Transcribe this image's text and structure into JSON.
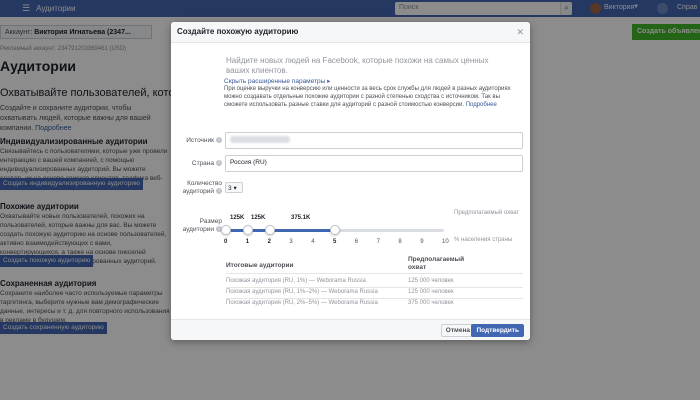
{
  "topbar": {
    "menu_icon": "menu-icon",
    "title": "Аудитории",
    "search_placeholder": "Поиск",
    "search_icon": "search-icon",
    "username": "Виктория",
    "help_label": "Справ"
  },
  "background": {
    "account_label": "Аккаунт:",
    "account_name": "Виктория Игнатьева (2347...",
    "create_button": "Создать объявление",
    "ad_account": "Рекламный аккаунт: 234791203369461 (USD)",
    "page_title": "Аудитории",
    "subtitle": "Охватывайте пользователей, которые",
    "desc": "Создайте и сохраните аудитории, чтобы охватывать людей, которые важны для вашей компании.",
    "desc_link": "Подробнее",
    "sections": [
      {
        "title": "Индивидуализированные аудитории",
        "desc": "Связывайтесь с пользователями, которые уже провели интеракцию с вашей компанией, с помощью индивидуализированных аудиторий. Вы можете создать их на основе списков клиентов, трафика веб-сайта или мобильного приложения.",
        "button": "Создать индивидуализированную аудиторию"
      },
      {
        "title": "Похожие аудитории",
        "desc": "Охватывайте новых пользователей, похожих на пользователей, которые важны для вас. Вы можете создать похожую аудиторию на основе пользователей, активно взаимодействующих с вами, конвертирующихся, а также на основе пикселей конверсии или индивидуализированных аудиторий.",
        "button": "Создать похожую аудиторию"
      },
      {
        "title": "Сохраненная аудитория",
        "desc": "Сохраните наиболее часто используемые параметры таргетинга, выберите нужные вам демографические данные, интересы и т. д. для повторного использования в рекламе в будущем.",
        "button": "Создать сохраненную аудиторию"
      }
    ]
  },
  "modal": {
    "title": "Создайте похожую аудиторию",
    "close_icon": "close-icon",
    "intro": "Найдите новых людей на Facebook, которые похожи на самых ценных ваших клиентов.",
    "advanced_link": "Скрыть расширенные параметры",
    "help_text": "При оценке выручки на конверсию или ценности за весь срок службы для людей в разных аудиториях можно создавать отдельные похожие аудитории с разной степенью сходства с источником. Так вы сможете использовать разные ставки для аудиторий с разной стоимостью конверсии.",
    "help_link": "Подробнее",
    "source_label": "Источник",
    "country_label": "Страна",
    "country_value": "Россия (RU)",
    "count_label": "Количество аудиторий",
    "count_value": "3",
    "size_label": "Размер аудитории",
    "predicted_reach_label": "Предполагаемый охват",
    "pct_label": "% населения страны",
    "size_values": [
      "125K",
      "125K",
      "375.1K"
    ],
    "slider_ticks": [
      "0",
      "1",
      "2",
      "3",
      "4",
      "5",
      "6",
      "7",
      "8",
      "9",
      "10"
    ],
    "slider_handles": [
      0,
      1,
      2,
      5
    ],
    "slider_max": 10,
    "table": {
      "headers": [
        "Итоговые аудитории",
        "Предполагаемый охват"
      ],
      "rows": [
        [
          "Похожая аудитория (RU, 1%) — Weborama Russia",
          "125 000 человек"
        ],
        [
          "Похожая аудитория (RU, 1%–2%) — Weborama Russia",
          "125 000 человек"
        ],
        [
          "Похожая аудитория (RU, 2%–5%) — Weborama Russia",
          "375 000 человек"
        ]
      ]
    },
    "cancel_button": "Отмена",
    "confirm_button": "Подтвердить"
  },
  "colors": {
    "brand": "#4267b2",
    "green": "#42b72a",
    "link": "#365899"
  }
}
